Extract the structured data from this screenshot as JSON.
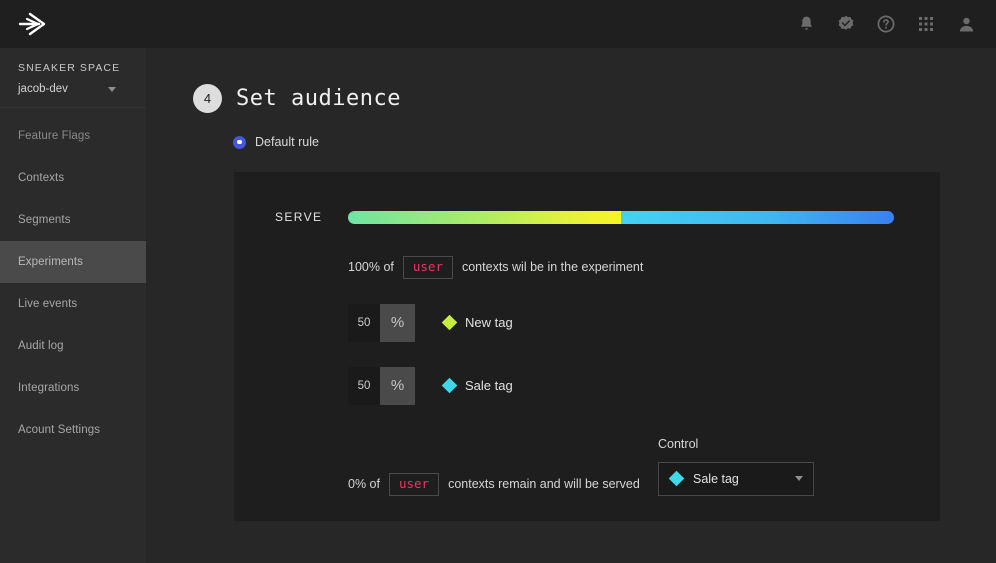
{
  "topbar": {
    "logo_name": "launch-arrow-logo",
    "icons": [
      {
        "name": "bell-icon",
        "label": "Notifications"
      },
      {
        "name": "verified-badge-icon",
        "label": "Verified"
      },
      {
        "name": "help-question-icon",
        "label": "Help"
      },
      {
        "name": "apps-grid-icon",
        "label": "Apps"
      },
      {
        "name": "account-person-icon",
        "label": "Account"
      }
    ]
  },
  "sidebar": {
    "project_name": "SNEAKER SPACE",
    "environment": "jacob-dev",
    "items": [
      {
        "label": "Feature Flags",
        "active": false
      },
      {
        "label": "Contexts",
        "active": false
      },
      {
        "label": "Segments",
        "active": false
      },
      {
        "label": "Experiments",
        "active": true
      },
      {
        "label": "Live events",
        "active": false
      },
      {
        "label": "Audit log",
        "active": false
      },
      {
        "label": "Integrations",
        "active": false
      },
      {
        "label": "Acount Settings",
        "active": false
      }
    ]
  },
  "main": {
    "step_number": "4",
    "step_title": "Set audience",
    "default_rule_label": "Default rule",
    "serve_label": "SERVE",
    "bar": {
      "left_percent": 50,
      "right_percent": 50,
      "left_gradient_start": "#6fe4a5",
      "left_gradient_end": "#f7f522",
      "right_gradient_start": "#45d2f2",
      "right_gradient_end": "#3a80ef"
    },
    "in_experiment": {
      "percent_text": "100% of",
      "context_kind": "user",
      "tail_text": "contexts wil be in the experiment"
    },
    "variations": [
      {
        "percent": "50",
        "unit": "%",
        "name": "New tag",
        "color": "#c5ed3f"
      },
      {
        "percent": "50",
        "unit": "%",
        "name": "Sale tag",
        "color": "#3fd8e8"
      }
    ],
    "remainder": {
      "percent_text": "0% of",
      "context_kind": "user",
      "tail_text": "contexts remain and will be served"
    },
    "control": {
      "label": "Control",
      "selected": "Sale tag",
      "selected_color": "#3fd8e8"
    }
  }
}
